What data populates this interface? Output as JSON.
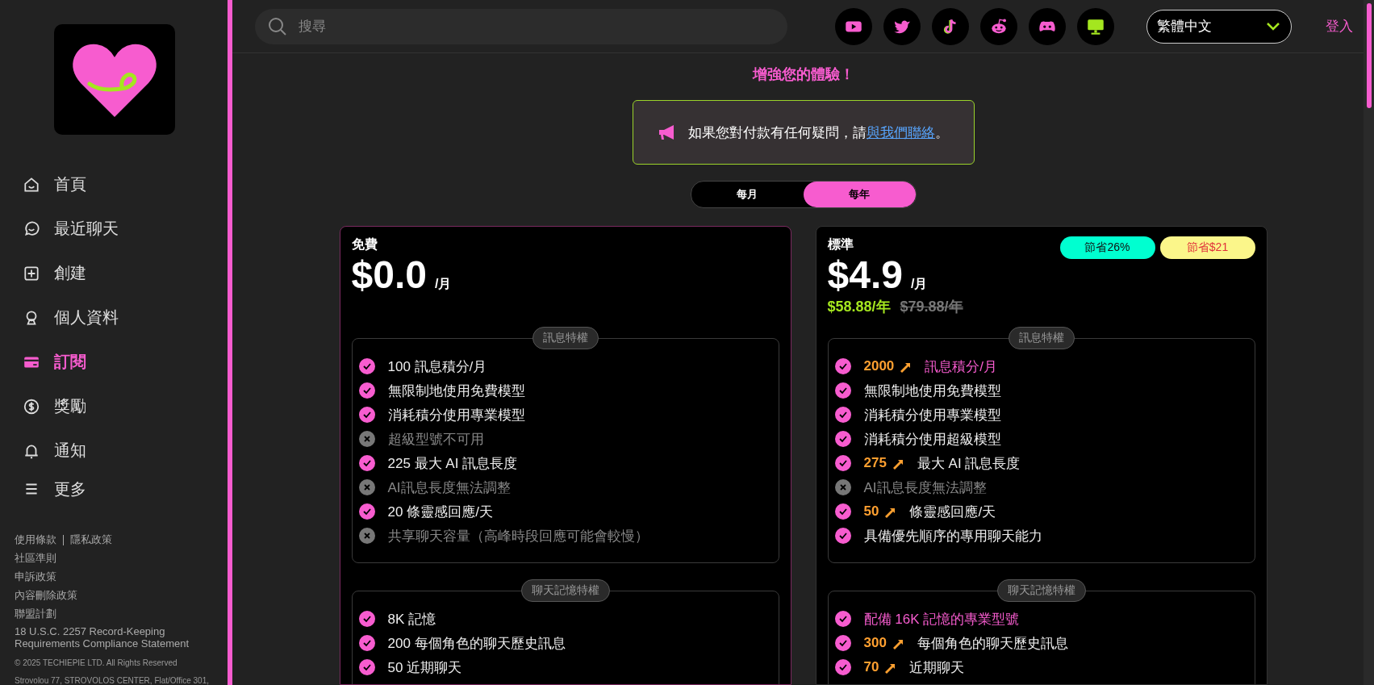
{
  "sidebar": {
    "items": [
      {
        "label": "首頁",
        "selected": false
      },
      {
        "label": "最近聊天",
        "selected": false
      },
      {
        "label": "創建",
        "selected": false
      },
      {
        "label": "個人資料",
        "selected": false
      },
      {
        "label": "訂閱",
        "selected": true
      },
      {
        "label": "獎勵",
        "selected": false
      },
      {
        "label": "通知",
        "selected": false
      },
      {
        "label": "更多",
        "selected": false
      }
    ],
    "footer_links_row": [
      "使用條款",
      "隱私政策"
    ],
    "footer_links": [
      "社區準則",
      "申訴政策",
      "內容刪除政策",
      "聯盟計劃",
      "18 U.S.C. 2257 Record-Keeping Requirements Compliance Statement"
    ],
    "copyright": "© 2025 TECHIEPIE LTD. All Rights Reserved",
    "address": "Strovolou 77, STROVOLOS CENTER, Flat/Office 301,"
  },
  "topbar": {
    "search": {
      "placeholder": "搜尋"
    },
    "language": "繁體中文",
    "login": "登入"
  },
  "heading": "增強您的體驗！",
  "notice": {
    "text": "如果您對付款有任何疑問，請",
    "link": "與我們聯絡",
    "end": "。"
  },
  "billing_tabs": [
    {
      "label": "每月",
      "selected": false
    },
    {
      "label": "每年",
      "selected": true
    }
  ],
  "plans": [
    {
      "name": "免費",
      "price": "$0.0",
      "unit": "/月",
      "sections": [
        {
          "title": "訊息特權",
          "items": [
            {
              "included": true,
              "text": "100 訊息積分/月",
              "highlight": false
            },
            {
              "included": true,
              "text": "無限制地使用免費模型",
              "highlight": false
            },
            {
              "included": true,
              "text": "消耗積分使用專業模型",
              "highlight": false
            },
            {
              "included": false,
              "text": "超級型號不可用",
              "highlight": false
            },
            {
              "included": true,
              "text": "225 最大 AI 訊息長度",
              "highlight": false
            },
            {
              "included": false,
              "text": "AI訊息長度無法調整",
              "highlight": false
            },
            {
              "included": true,
              "text": "20 條靈感回應/天",
              "highlight": false
            },
            {
              "included": false,
              "text": "共享聊天容量（高峰時段回應可能會較慢）",
              "highlight": false
            }
          ]
        },
        {
          "title": "聊天記憶特權",
          "items": [
            {
              "included": true,
              "text": "8K 記憶",
              "highlight": false
            },
            {
              "included": true,
              "text": "200 每個角色的聊天歷史訊息",
              "highlight": false
            },
            {
              "included": true,
              "text": "50 近期聊天",
              "highlight": false
            }
          ]
        }
      ]
    },
    {
      "name": "標準",
      "price": "$4.9",
      "unit": "/月",
      "yearly": "$58.88/年",
      "original": "$79.88/年",
      "badges": [
        {
          "text": "節省26%",
          "color": "#00ffd0"
        },
        {
          "text": "節省$21",
          "color": "#fbf68a"
        }
      ],
      "sections": [
        {
          "title": "訊息特權",
          "items": [
            {
              "included": true,
              "value": "2000",
              "text": "訊息積分/月",
              "highlight": true
            },
            {
              "included": true,
              "text": "無限制地使用免費模型",
              "highlight": false
            },
            {
              "included": true,
              "text": "消耗積分使用專業模型",
              "highlight": false
            },
            {
              "included": true,
              "text": "消耗積分使用超級模型",
              "highlight": false
            },
            {
              "included": true,
              "value": "275",
              "text": "最大 AI 訊息長度",
              "highlight": false
            },
            {
              "included": false,
              "text": "AI訊息長度無法調整",
              "highlight": false
            },
            {
              "included": true,
              "value": "50",
              "text": "條靈感回應/天",
              "highlight": false
            },
            {
              "included": true,
              "text": "具備優先順序的專用聊天能力",
              "highlight": false
            }
          ]
        },
        {
          "title": "聊天記憶特權",
          "items": [
            {
              "included": true,
              "text": "配備 16K 記憶的專業型號",
              "highlight": true
            },
            {
              "included": true,
              "value": "300",
              "text": "每個角色的聊天歷史訊息",
              "highlight": false
            },
            {
              "included": true,
              "value": "70",
              "text": "近期聊天",
              "highlight": false
            }
          ]
        }
      ]
    }
  ]
}
